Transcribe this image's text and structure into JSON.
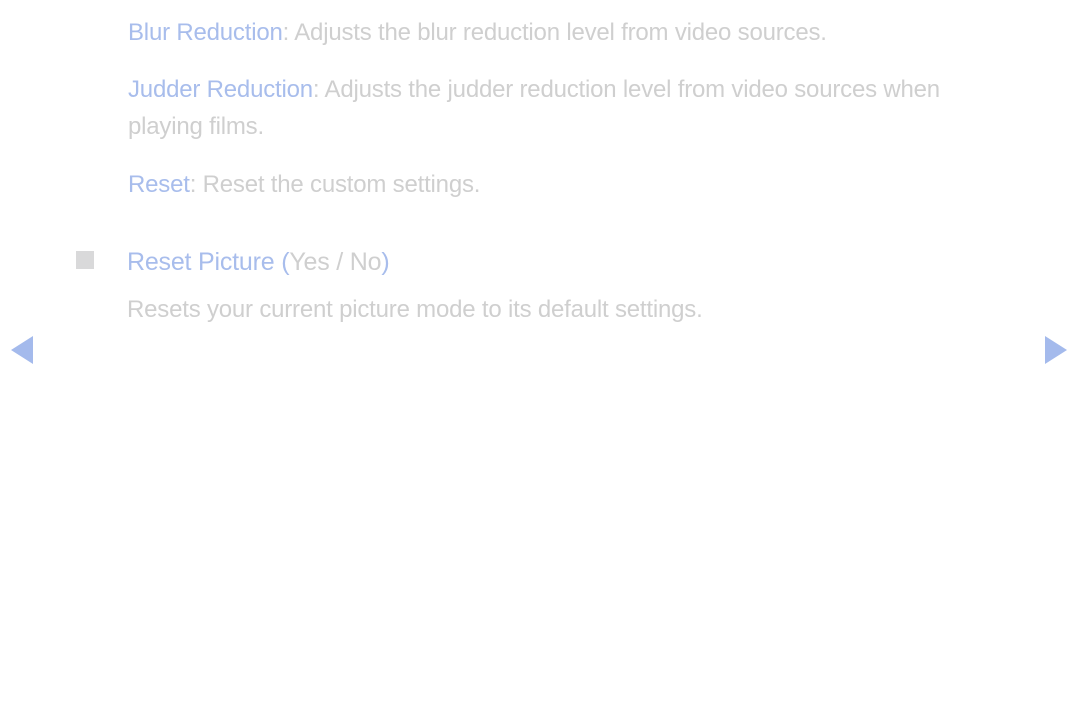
{
  "content": {
    "items": [
      {
        "term": "Blur Reduction",
        "desc": ": Adjusts the blur reduction level from video sources."
      },
      {
        "term": "Judder Reduction",
        "desc": ": Adjusts the judder reduction level from video sources when playing films."
      },
      {
        "term": "Reset",
        "desc": ": Reset the custom settings."
      }
    ]
  },
  "section": {
    "title": "Reset Picture",
    "paren_open": " (",
    "options": "Yes / No",
    "paren_close": ")",
    "desc": "Resets your current picture mode to its default settings."
  },
  "colors": {
    "accent": "#a8bdec",
    "text_muted": "#cfcfcf",
    "bullet": "#d9d9da",
    "arrow": "#a4baec"
  }
}
